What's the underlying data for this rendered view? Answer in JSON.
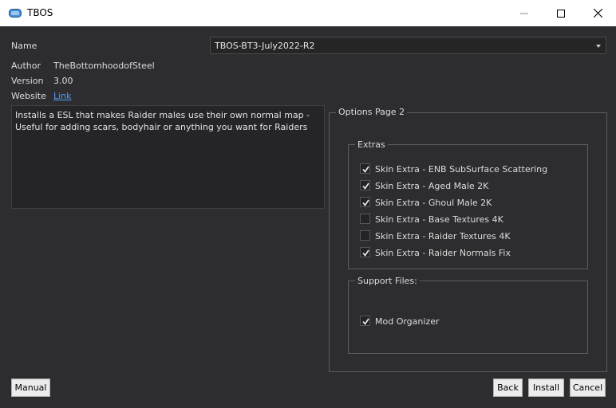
{
  "window": {
    "title": "TBOS",
    "minimize_label": "—",
    "maximize_label": "☐",
    "close_label": "✕"
  },
  "info": {
    "name_label": "Name",
    "name_value": "TBOS-BT3-July2022-R2",
    "author_label": "Author",
    "author_value": "TheBottomhoodofSteel",
    "version_label": "Version",
    "version_value": "3.00",
    "website_label": "Website",
    "website_link": "Link"
  },
  "description": "Installs a ESL that makes Raider males use their own normal map - Useful for adding scars, bodyhair or anything you want for Raiders",
  "options": {
    "page_title": "Options Page 2",
    "extras": {
      "title": "Extras",
      "items": [
        {
          "label": "Skin Extra - ENB SubSurface Scattering",
          "checked": true
        },
        {
          "label": "Skin Extra - Aged Male 2K",
          "checked": true
        },
        {
          "label": "Skin Extra - Ghoul Male 2K",
          "checked": true
        },
        {
          "label": "Skin Extra - Base Textures 4K",
          "checked": false
        },
        {
          "label": "Skin Extra - Raider Textures 4K",
          "checked": false
        },
        {
          "label": "Skin Extra - Raider Normals Fix",
          "checked": true
        }
      ]
    },
    "support": {
      "title": "Support Files:",
      "items": [
        {
          "label": "Mod Organizer",
          "checked": true
        }
      ]
    }
  },
  "buttons": {
    "manual": "Manual",
    "back": "Back",
    "install": "Install",
    "cancel": "Cancel"
  },
  "colors": {
    "background": "#2d2d30",
    "link": "#4e9fff",
    "accent": "#4a90d9"
  }
}
